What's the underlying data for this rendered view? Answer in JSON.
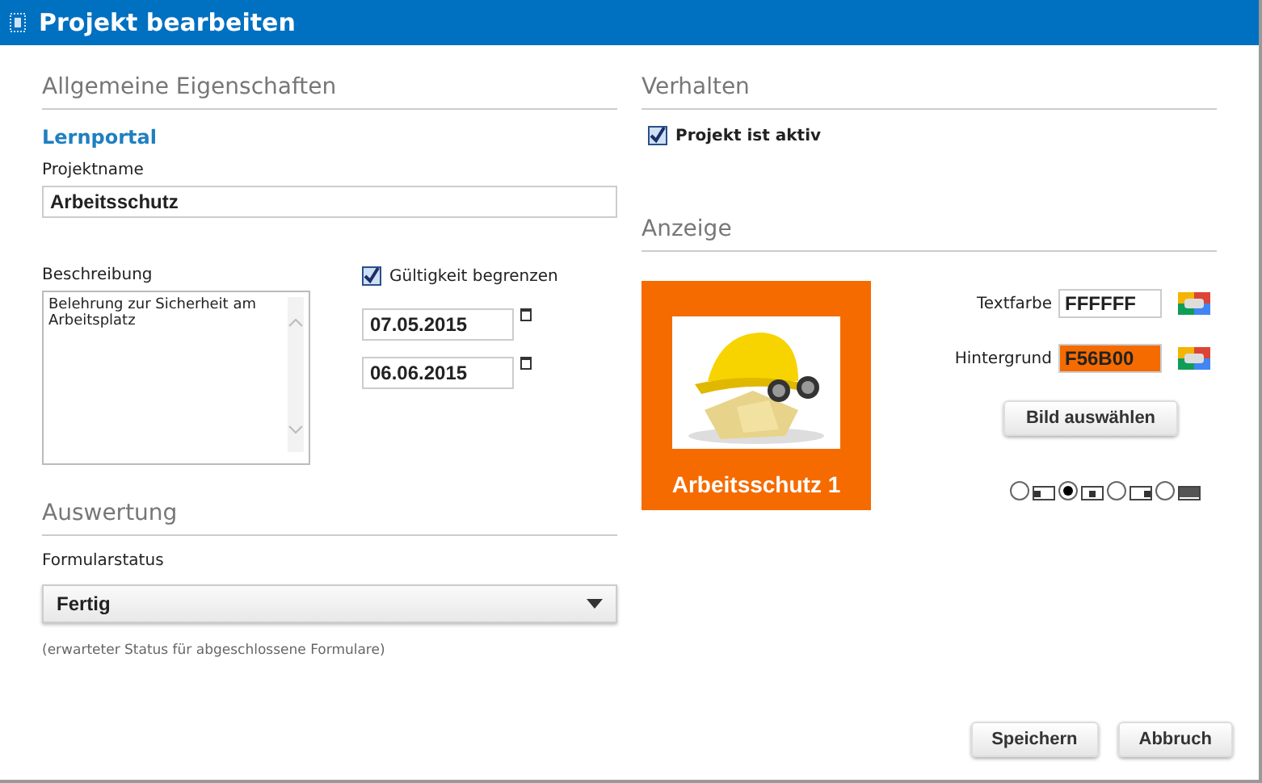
{
  "window": {
    "title": "Projekt bearbeiten"
  },
  "general": {
    "heading": "Allgemeine Eigenschaften",
    "portal": "Lernportal",
    "name_label": "Projektname",
    "name_value": "Arbeitsschutz",
    "description_label": "Beschreibung",
    "description_value": "Belehrung zur Sicherheit am Arbeitsplatz",
    "limit_validity": {
      "label": "Gültigkeit begrenzen",
      "checked": true
    },
    "date_from": "07.05.2015",
    "date_to": "06.06.2015"
  },
  "evaluation": {
    "heading": "Auswertung",
    "status_label": "Formularstatus",
    "status_value": "Fertig",
    "hint": "(erwarteter Status für abgeschlossene Formulare)"
  },
  "behavior": {
    "heading": "Verhalten",
    "active": {
      "label": "Projekt ist aktiv",
      "checked": true
    }
  },
  "display": {
    "heading": "Anzeige",
    "preview": {
      "caption": "Arbeitsschutz 1",
      "kind": "picture"
    },
    "text_color": {
      "label": "Textfarbe",
      "value": "FFFFFF"
    },
    "background": {
      "label": "Hintergrund",
      "value": "F56B00"
    },
    "choose_image": "Bild auswählen",
    "placement": [
      {
        "kind": "left",
        "selected": false
      },
      {
        "kind": "center",
        "selected": true
      },
      {
        "kind": "right",
        "selected": false
      },
      {
        "kind": "fill",
        "selected": false
      }
    ]
  },
  "buttons": [
    "Speichern",
    "Abbruch"
  ]
}
